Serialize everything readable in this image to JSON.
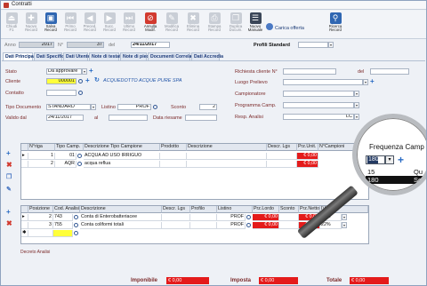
{
  "window": {
    "title": "Contratti"
  },
  "toolbar": {
    "buttons": [
      {
        "label": "Chiudi",
        "sub": "F1"
      },
      {
        "label": "Nuovo",
        "sub": "Record"
      },
      {
        "label": "Salva",
        "sub": "Record"
      },
      {
        "label": "Primo",
        "sub": "Record"
      },
      {
        "label": "Preced.",
        "sub": "Record"
      },
      {
        "label": "Succ.",
        "sub": "Record"
      },
      {
        "label": "Ultimo",
        "sub": "Record"
      },
      {
        "label": "Annulla",
        "sub": "Modif."
      },
      {
        "label": "Modifica",
        "sub": "Record"
      },
      {
        "label": "Elimina",
        "sub": "Record"
      },
      {
        "label": "Stampa",
        "sub": "Record"
      },
      {
        "label": "Duplica",
        "sub": "Docum."
      },
      {
        "label": "Nuovo",
        "sub": "Manuale"
      }
    ],
    "load_offer": "Carica offerta",
    "search": {
      "label": "Ricerca",
      "sub": "Record"
    }
  },
  "header": {
    "anno_label": "Anno",
    "anno": "2017",
    "nr_label": "N°",
    "nr": "37",
    "del_label": "del",
    "date": "24/11/2017",
    "profile": "Profili Standard"
  },
  "tabs": [
    "Dati Principali",
    "Dati Specifici",
    "Dati Utente",
    "Note di testata",
    "Note di piede",
    "Documenti Correlati",
    "Dati Accredia"
  ],
  "form": {
    "stato_label": "Stato",
    "stato": "Da approvare",
    "cliente_label": "Cliente",
    "cliente_code": "000001",
    "cliente_name": "ACQUEDOTTO ACQUE PURE SPA",
    "contatto_label": "Contatto",
    "tipo_doc_label": "Tipo Documento",
    "tipo_doc": "STANDARD",
    "listino_label": "Listino",
    "listino": "PROF",
    "sconto_label": "Sconto",
    "sconto": "2",
    "valido_label": "Valido dal",
    "valido_dal": "24/11/2017",
    "al_label": "al",
    "data_riesame_label": "Data riesame",
    "richiesta_label": "Richiesta cliente N°",
    "richiesta_del_label": "del",
    "luogo_label": "Luogo Prelievo",
    "campionatore_label": "Campionatore",
    "programma_label": "Programma Camp.",
    "resp_label": "Resp. Analisi",
    "resp": "LC"
  },
  "upper_grid": {
    "headers": [
      "N°riga",
      "Tipo Camp.",
      "Descrizione Tipo Campione",
      "Prodotto",
      "Descrizione",
      "Descr. Lgs",
      "Prz.Unit.",
      "N°Campioni"
    ],
    "rows": [
      {
        "n": "1",
        "tipo": "01",
        "desc_tipo": "ACQUA AD USO IRRIGUO",
        "prezzo": "€ 0,00"
      },
      {
        "n": "2",
        "tipo": "AQR",
        "desc_tipo": "acqua reflua",
        "prezzo": "€ 0,00"
      }
    ]
  },
  "lower_grid": {
    "headers": [
      "Posizione",
      "Cod. Analisi",
      "Descrizione",
      "Descr. Lgs",
      "Profilo",
      "Listino",
      "Prz.Lordo",
      "Sconto",
      "Prz.Netto",
      "IVA"
    ],
    "rows": [
      {
        "pos": "2",
        "cod": "743",
        "desc": "Conta di Enterobatteriacee",
        "listino": "PROF",
        "prz": "€ 0,00",
        "iva": "22%"
      },
      {
        "pos": "3",
        "cod": "755",
        "desc": "Conta coliformi totali",
        "listino": "PROF",
        "prz": "€ 0,00",
        "iva": "22%"
      }
    ]
  },
  "footer": {
    "decreto": "Decreto Analisi",
    "imponibile_label": "Imponibile",
    "imponibile": "€ 0,00",
    "imposta_label": "Imposta",
    "imposta": "€ 0,00",
    "totale_label": "Totale",
    "totale": "€ 0,00"
  },
  "magnifier": {
    "title": "Frequenza Camp",
    "selected": "180",
    "options": [
      {
        "value": "15",
        "extra": "Qu"
      },
      {
        "value": "180",
        "extra": "Se"
      }
    ]
  }
}
